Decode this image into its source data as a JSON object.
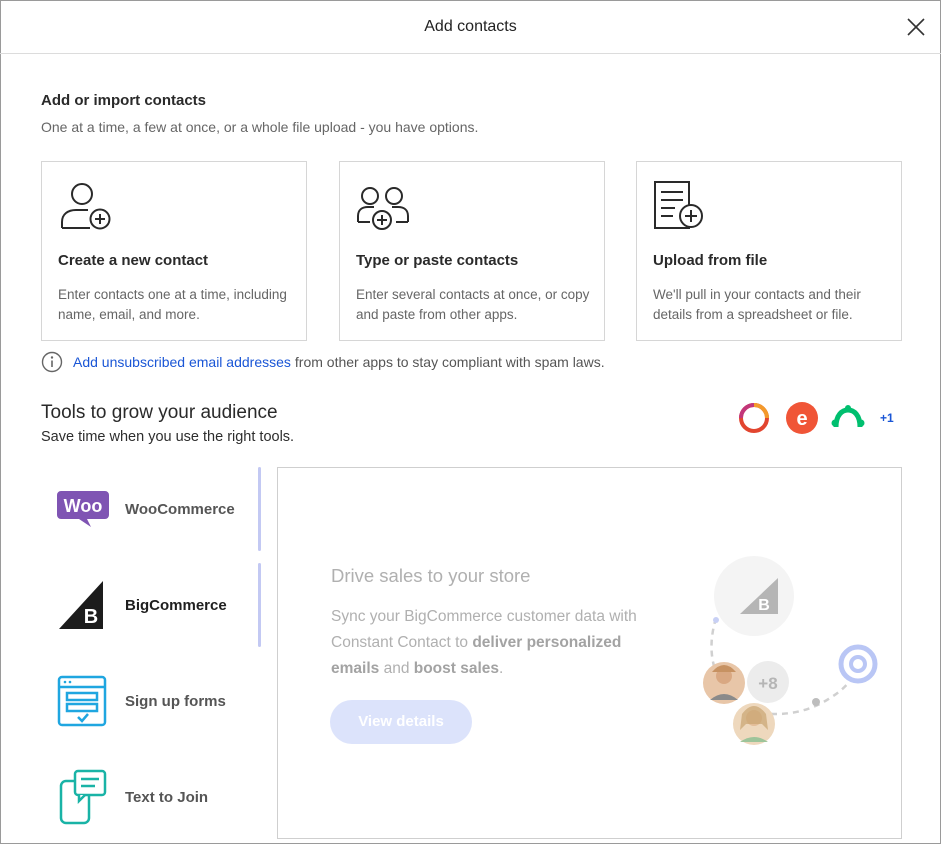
{
  "dialog": {
    "title": "Add contacts"
  },
  "import_section": {
    "title": "Add or import contacts",
    "subtitle": "One at a time, a few at once, or a whole file upload - you have options."
  },
  "cards": [
    {
      "title": "Create a new contact",
      "description": "Enter contacts one at a time, including name, email, and more.",
      "icon": "person-add-icon"
    },
    {
      "title": "Type or paste contacts",
      "description": "Enter several contacts at once, or copy and paste from other apps.",
      "icon": "people-add-icon"
    },
    {
      "title": "Upload from file",
      "description": "We'll pull in your contacts and their details from a spreadsheet or file.",
      "icon": "file-add-icon"
    }
  ],
  "notice": {
    "link_text": "Add unsubscribed email addresses",
    "rest_text": "from other apps to stay compliant with spam laws."
  },
  "tools": {
    "title": "Tools to grow your audience",
    "subtitle": "Save time when you use the right tools.",
    "more_count": "+1",
    "tabs": [
      {
        "label": "WooCommerce",
        "icon": "woocommerce-logo-icon"
      },
      {
        "label": "BigCommerce",
        "icon": "bigcommerce-logo-icon"
      },
      {
        "label": "Sign up forms",
        "icon": "form-icon"
      },
      {
        "label": "Text to Join",
        "icon": "sms-icon"
      }
    ],
    "active_tab": "BigCommerce"
  },
  "panel": {
    "title": "Drive sales to your store",
    "desc_part1": "Sync your BigCommerce customer data with Constant Contact to ",
    "desc_bold1": "deliver personalized emails",
    "desc_part2": " and ",
    "desc_bold2": "boost sales",
    "desc_part3": ".",
    "button_label": "View details",
    "badge_count": "+8"
  },
  "colors": {
    "link": "#1a56d6",
    "tab_bar": "#c3c9f3",
    "button_bg": "#dce3fb",
    "woocommerce": "#7f54b3",
    "eventbrite": "#f05537",
    "surveymonkey": "#00bf6f",
    "form_icon": "#1fa6e0",
    "sms_icon": "#19b3a6"
  }
}
